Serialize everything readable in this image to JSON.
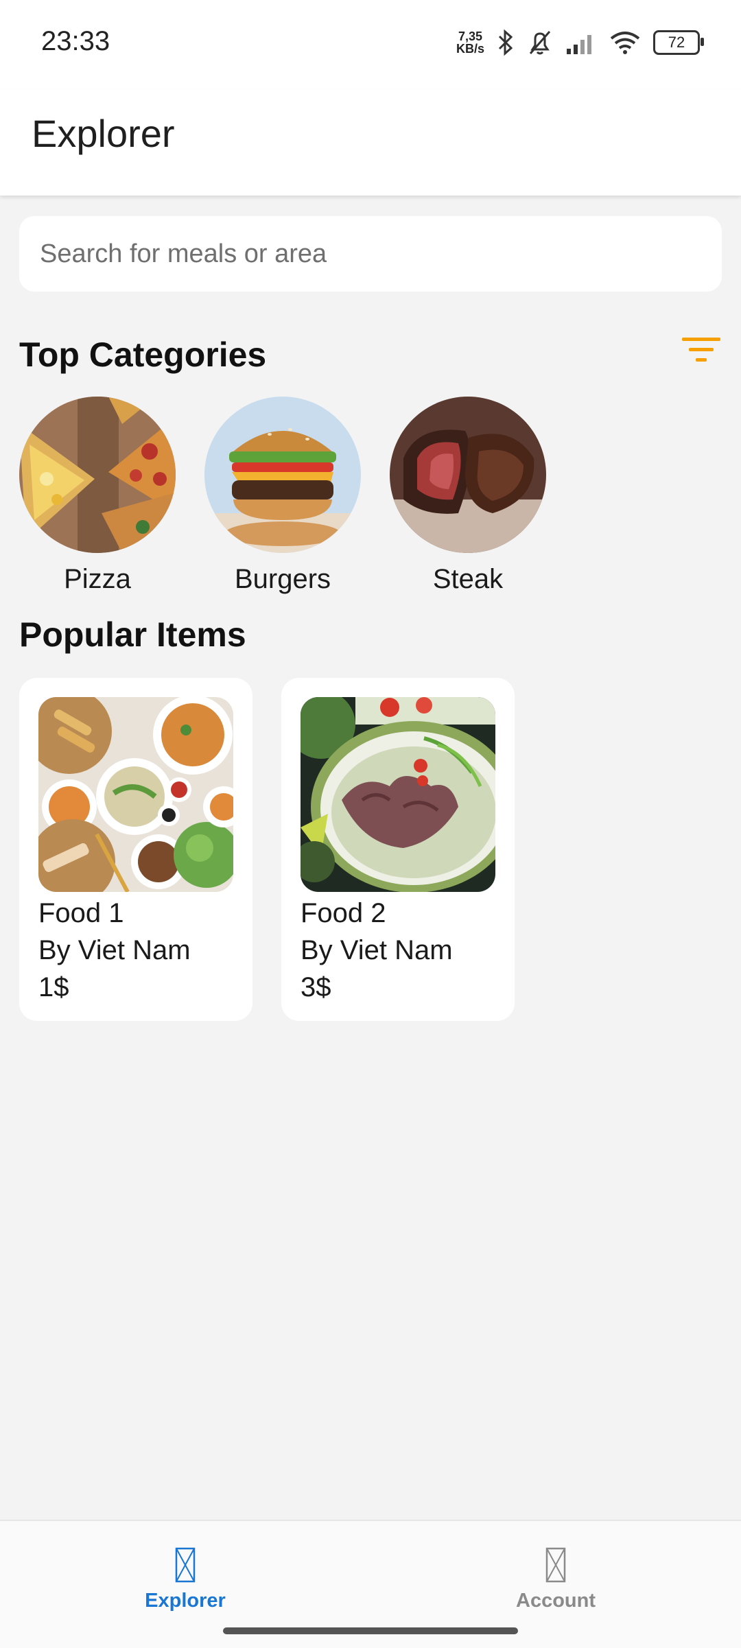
{
  "status_bar": {
    "time": "23:33",
    "net_speed_value": "7,35",
    "net_speed_unit": "KB/s",
    "battery": "72",
    "icons": [
      "bluetooth-icon",
      "mute-bell-icon",
      "signal-icon",
      "wifi-icon",
      "battery-icon"
    ]
  },
  "app_bar": {
    "title": "Explorer"
  },
  "search": {
    "placeholder": "Search for meals or area",
    "value": ""
  },
  "top_categories": {
    "title": "Top Categories",
    "filter_icon_color": "#f5a000",
    "items": [
      {
        "label": "Pizza"
      },
      {
        "label": "Burgers"
      },
      {
        "label": "Steak"
      }
    ]
  },
  "popular_items": {
    "title": "Popular Items",
    "items": [
      {
        "name": "Food 1",
        "by": "By Viet Nam",
        "price": "1$"
      },
      {
        "name": "Food 2",
        "by": "By Viet Nam",
        "price": "3$"
      }
    ]
  },
  "bottom_nav": {
    "active_color": "#1976d2",
    "inactive_color": "#8a8a8a",
    "items": [
      {
        "label": "Explorer",
        "active": true
      },
      {
        "label": "Account",
        "active": false
      }
    ]
  }
}
